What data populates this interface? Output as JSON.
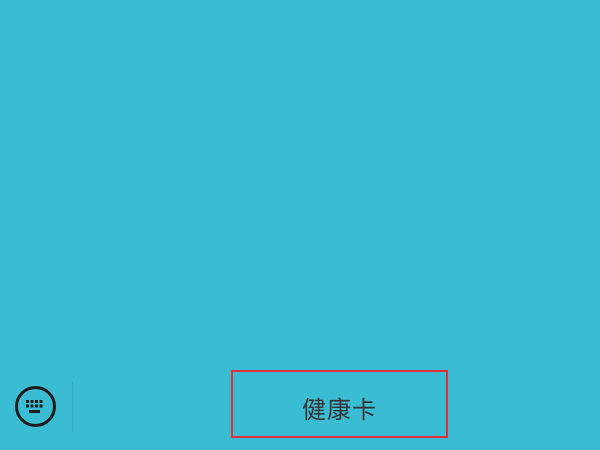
{
  "colors": {
    "background": "#3abdd2",
    "highlight_border": "#e0313a",
    "icon": "#1c1c1c",
    "text": "#333333"
  },
  "bottom_bar": {
    "keyboard_toggle_icon": "keyboard-icon",
    "menu_items": [
      {
        "label": "健康卡"
      }
    ]
  }
}
